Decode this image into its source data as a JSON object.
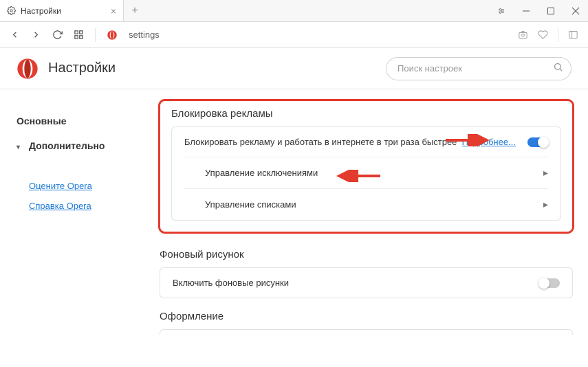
{
  "tab": {
    "title": "Настройки"
  },
  "addressbar": {
    "url": "settings"
  },
  "header": {
    "title": "Настройки"
  },
  "search": {
    "placeholder": "Поиск настроек"
  },
  "sidebar": {
    "items": [
      "Основные",
      "Дополнительно"
    ],
    "links": [
      "Оцените Opera",
      "Справка Opera"
    ]
  },
  "adblock": {
    "title": "Блокировка рекламы",
    "desc": "Блокировать рекламу и работать в интернете в три раза быстрее",
    "learn_more": "Подробнее...",
    "exceptions": "Управление исключениями",
    "lists": "Управление списками"
  },
  "wallpaper": {
    "title": "Фоновый рисунок",
    "enable": "Включить фоновые рисунки"
  },
  "appearance": {
    "title": "Оформление"
  }
}
